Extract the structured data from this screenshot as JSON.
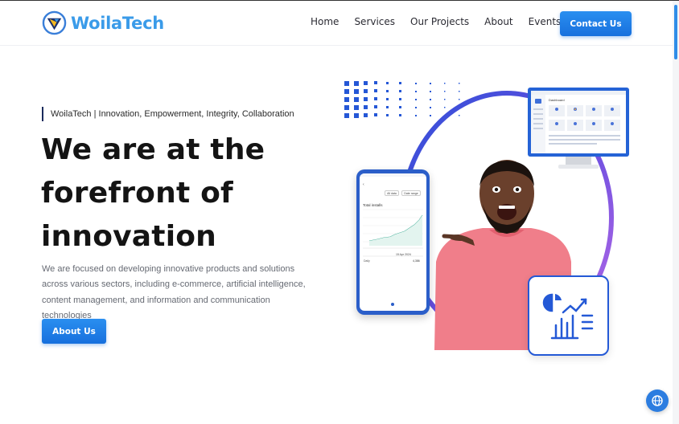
{
  "brand": {
    "name": "WoilaTech",
    "colors": {
      "primary": "#3a9be9",
      "button": "#1e7fe6",
      "ring": "#5b3fd8",
      "phone": "#2b5ec9"
    }
  },
  "nav": {
    "items": [
      "Home",
      "Services",
      "Our Projects",
      "About",
      "Events"
    ],
    "cta_label": "Contact Us"
  },
  "hero": {
    "tagline": "WoilaTech | Innovation, Empowerment, Integrity, Collaboration",
    "headline": [
      "We are at the",
      "forefront of",
      "innovation"
    ],
    "description": "We are focused on developing innovative products and solutions across various sectors, including e-commerce, artificial intelligence, content management, and information and communication technologies",
    "button_label": "About Us"
  },
  "phone_mockup": {
    "pill_1": "All data",
    "pill_2": "Date range",
    "title": "Total installs",
    "date": "15 Apr 2024",
    "row_label": "Daily",
    "row_value": "4,386"
  },
  "monitor_mockup": {
    "heading": "Dashboard"
  },
  "icons": {
    "logo": "woilatech-logo-icon",
    "chat": "globe-chat-icon",
    "card": "analytics-chart-icon"
  }
}
